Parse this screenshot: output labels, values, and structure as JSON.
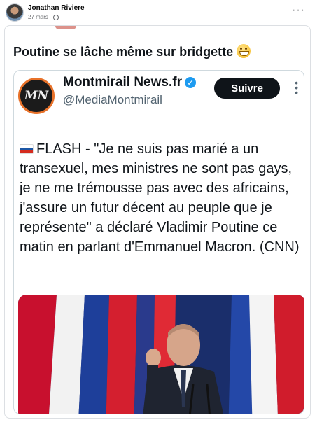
{
  "post": {
    "author": "Jonathan Riviere",
    "date": "27 mars",
    "visibility_icon": "globe-icon",
    "more_label": "···"
  },
  "shared": {
    "text": "Poutine se lâche même sur bridgette",
    "emoji": "grinning-face-icon"
  },
  "tweet": {
    "account_name": "Montmirail News.fr",
    "handle": "@MediaMontmirail",
    "avatar_mark": "MN",
    "follow_label": "Suivre",
    "flag": "russia-flag-icon",
    "body": "FLASH - \"Je ne suis pas marié a un transexuel, mes ministres ne sont pas gays, je ne me trémousse pas avec des africains, j'assure un futur décent au peuple que je représente\" a déclaré Vladimir Poutine ce matin en parlant d'Emmanuel Macron. (CNN)"
  },
  "colors": {
    "follow_bg": "#0f1419",
    "verified": "#1d9bf0",
    "avatar_ring": "#e8722a",
    "flag_blue": "#1c57a5",
    "flag_red": "#d52b1e"
  }
}
